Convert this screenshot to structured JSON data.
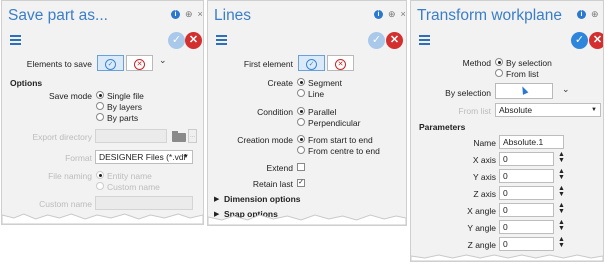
{
  "panel1": {
    "title": "Save part as...",
    "elements_to_save_label": "Elements to save",
    "options_heading": "Options",
    "save_mode_label": "Save mode",
    "save_mode_options": [
      "Single file",
      "By layers",
      "By parts"
    ],
    "export_directory_label": "Export directory",
    "format_label": "Format",
    "format_value": "DESIGNER Files (*.vdf",
    "file_naming_label": "File naming",
    "file_naming_options": [
      "Entity name",
      "Custom name"
    ],
    "custom_name_label": "Custom name"
  },
  "panel2": {
    "title": "Lines",
    "first_element_label": "First element",
    "create_label": "Create",
    "create_options": [
      "Segment",
      "Line"
    ],
    "condition_label": "Condition",
    "condition_options": [
      "Parallel",
      "Perpendicular"
    ],
    "creation_mode_label": "Creation mode",
    "creation_mode_options": [
      "From start to end",
      "From centre to end"
    ],
    "extend_label": "Extend",
    "retain_last_label": "Retain last",
    "dimension_options_label": "Dimension options",
    "snap_options_label": "Snap options"
  },
  "panel3": {
    "title": "Transform workplane",
    "method_label": "Method",
    "method_options": [
      "By selection",
      "From list"
    ],
    "by_selection_label": "By selection",
    "from_list_label": "From list",
    "from_list_value": "Absolute",
    "parameters_heading": "Parameters",
    "name_label": "Name",
    "name_value": "Absolute.1",
    "params": [
      {
        "label": "X axis",
        "value": "0"
      },
      {
        "label": "Y axis",
        "value": "0"
      },
      {
        "label": "Z axis",
        "value": "0"
      },
      {
        "label": "X angle",
        "value": "0"
      },
      {
        "label": "Y angle",
        "value": "0"
      },
      {
        "label": "Z angle",
        "value": "0"
      }
    ]
  },
  "icons": {
    "info": "i",
    "pin": "⊕",
    "close": "×",
    "ok": "✓",
    "cancel": "✕",
    "chevron": "⌄",
    "check": "✓",
    "dots": "...",
    "expand": "▶",
    "spin": "▲▼"
  },
  "colors": {
    "title_blue": "#3b7ec8",
    "ok_blue": "#2d86dc",
    "cancel_red": "#d32f2f",
    "panel_bg": "#f2f2f2"
  }
}
